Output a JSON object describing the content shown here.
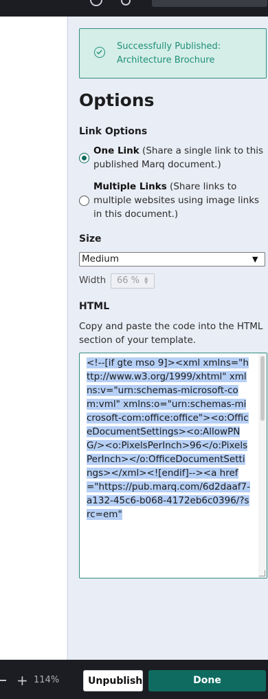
{
  "banner": {
    "line1": "Successfully Published:",
    "line2": "Architecture Brochure"
  },
  "options": {
    "title": "Options",
    "link_options_label": "Link Options",
    "one_link": {
      "label": "One Link",
      "desc": " (Share a single link to this published Marq document.)",
      "selected": true
    },
    "multiple_links": {
      "label": "Multiple Links",
      "desc": " (Share links to multiple websites using image links in this document.)",
      "selected": false
    },
    "size_label": "Size",
    "size_value": "Medium",
    "width_label": "Width",
    "width_value": "66 %",
    "html_label": "HTML",
    "html_desc": "Copy and paste the code into the HTML section of your template.",
    "html_code": "<!--[if gte mso 9]><xml xmlns=\"http://www.w3.org/1999/xhtml\" xmlns:v=\"urn:schemas-microsoft-com:vml\" xmlns:o=\"urn:schemas-microsoft-com:office:office\"><o:OfficeDocumentSettings><o:AllowPNG/><o:PixelsPerInch>96</o:PixelsPerInch></o:OfficeDocumentSettings></xml><![endif]--><a href=\"https://pub.marq.com/6d2daaf7-a132-45c6-b068-4172eb6c0396/?src=em\""
  },
  "footer": {
    "unpublish_label": "Unpublish",
    "done_label": "Done"
  },
  "zoom": {
    "level": "114%"
  },
  "colors": {
    "accent": "#0f6b60",
    "success_bg": "#d5eee8",
    "success_text": "#1f8f78",
    "selection": "#b6cff5"
  }
}
